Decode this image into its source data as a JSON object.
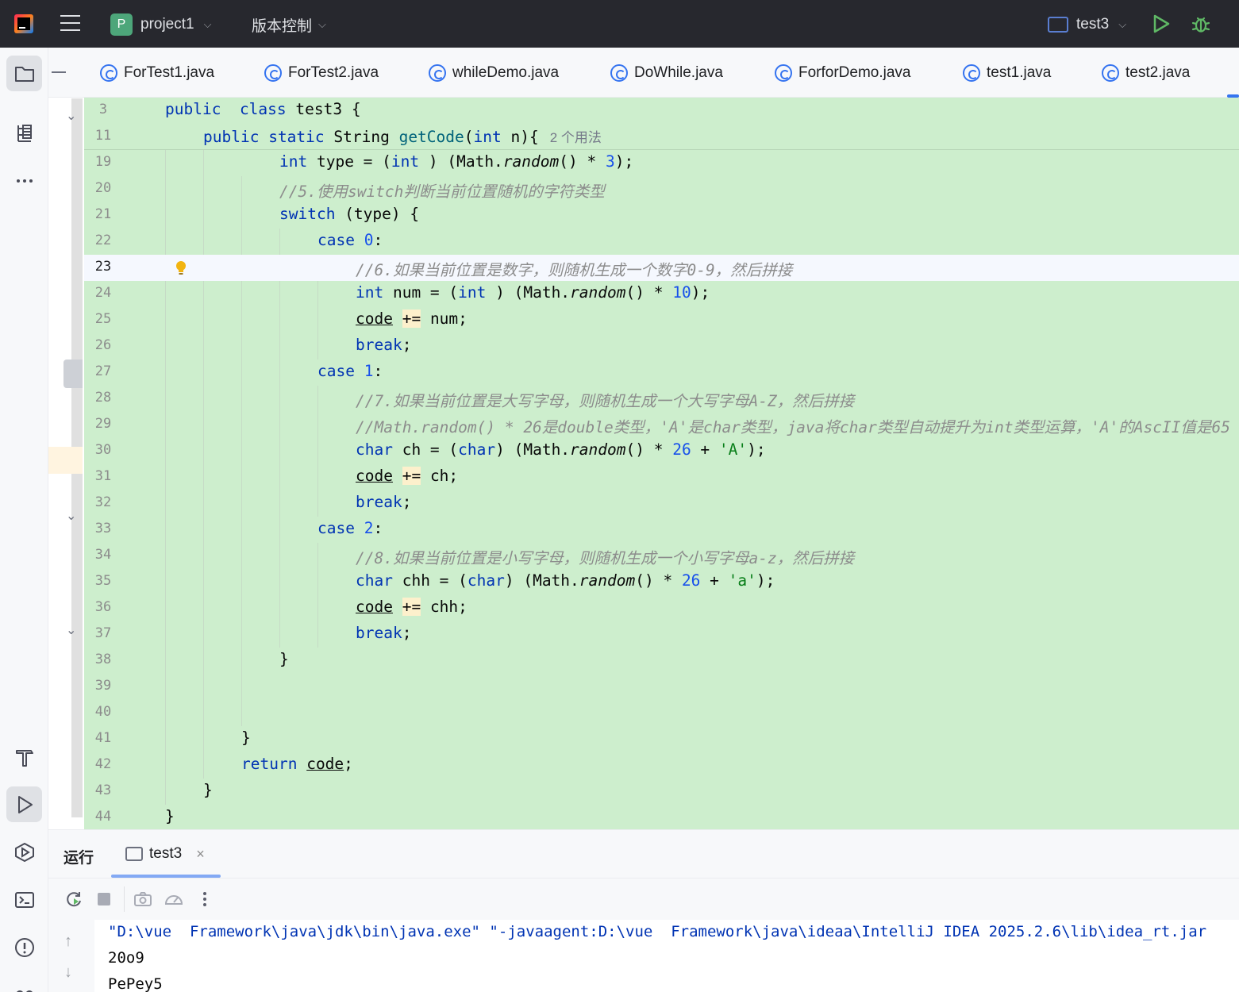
{
  "titlebar": {
    "project_badge": "P",
    "project_name": "project1",
    "vcs_label": "版本控制",
    "run_config": "test3"
  },
  "tabs": [
    {
      "label": "ForTest1.java"
    },
    {
      "label": "ForTest2.java"
    },
    {
      "label": "whileDemo.java"
    },
    {
      "label": "DoWhile.java"
    },
    {
      "label": "ForforDemo.java"
    },
    {
      "label": "test1.java"
    },
    {
      "label": "test2.java"
    }
  ],
  "editor": {
    "caret_line": 23,
    "inlay_hint": "2 个用法",
    "lines": [
      {
        "n": "3",
        "indent": 2,
        "tokens": [
          [
            "kw",
            "public"
          ],
          [
            "",
            "  "
          ],
          [
            "kw",
            "class"
          ],
          [
            "",
            " test3 {"
          ]
        ]
      },
      {
        "n": "11",
        "indent": 3,
        "tokens": [
          [
            "kw",
            "public"
          ],
          [
            "",
            " "
          ],
          [
            "kw",
            "static"
          ],
          [
            "",
            " String "
          ],
          [
            "fn",
            "getCode"
          ],
          [
            "",
            "("
          ],
          [
            "kw",
            "int"
          ],
          [
            "",
            " n){"
          ]
        ],
        "hint": true
      },
      {
        "n": "19",
        "indent": 5,
        "tokens": [
          [
            "kw",
            "int"
          ],
          [
            "",
            " type = ("
          ],
          [
            "kw",
            "int"
          ],
          [
            "",
            " ) (Math."
          ],
          [
            "it",
            "random"
          ],
          [
            "",
            "() * "
          ],
          [
            "num",
            "3"
          ],
          [
            "",
            ");"
          ]
        ]
      },
      {
        "n": "20",
        "indent": 5,
        "tokens": [
          [
            "cm",
            "//5.使用switch判断当前位置随机的字符类型"
          ]
        ]
      },
      {
        "n": "21",
        "indent": 5,
        "tokens": [
          [
            "kw",
            "switch"
          ],
          [
            "",
            " (type) {"
          ]
        ]
      },
      {
        "n": "22",
        "indent": 6,
        "tokens": [
          [
            "kw",
            "case"
          ],
          [
            "",
            " "
          ],
          [
            "num",
            "0"
          ],
          [
            "",
            ":"
          ]
        ]
      },
      {
        "n": "23",
        "indent": 7,
        "tokens": [
          [
            "cm",
            "//6.如果当前位置是数字，则随机生成一个数字0-9，然后拼接"
          ]
        ],
        "bulb": true
      },
      {
        "n": "24",
        "indent": 7,
        "tokens": [
          [
            "kw",
            "int"
          ],
          [
            "",
            " num = ("
          ],
          [
            "kw",
            "int"
          ],
          [
            "",
            " ) (Math."
          ],
          [
            "it",
            "random"
          ],
          [
            "",
            "() * "
          ],
          [
            "num",
            "10"
          ],
          [
            "",
            ");"
          ]
        ]
      },
      {
        "n": "25",
        "indent": 7,
        "tokens": [
          [
            "ul",
            "code"
          ],
          [
            "",
            " "
          ],
          [
            "op",
            "+="
          ],
          [
            "",
            " num;"
          ]
        ]
      },
      {
        "n": "26",
        "indent": 7,
        "tokens": [
          [
            "kw",
            "break"
          ],
          [
            "",
            ";"
          ]
        ]
      },
      {
        "n": "27",
        "indent": 6,
        "tokens": [
          [
            "kw",
            "case"
          ],
          [
            "",
            " "
          ],
          [
            "num",
            "1"
          ],
          [
            "",
            ":"
          ]
        ]
      },
      {
        "n": "28",
        "indent": 7,
        "tokens": [
          [
            "cm",
            "//7.如果当前位置是大写字母，则随机生成一个大写字母A-Z，然后拼接"
          ]
        ]
      },
      {
        "n": "29",
        "indent": 7,
        "tokens": [
          [
            "cm",
            "//Math.random() * 26是double类型，'A'是char类型，java将char类型自动提升为int类型运算，'A'的AscII值是65"
          ]
        ]
      },
      {
        "n": "30",
        "indent": 7,
        "tokens": [
          [
            "kw",
            "char"
          ],
          [
            "",
            " ch = ("
          ],
          [
            "kw",
            "char"
          ],
          [
            "",
            ") (Math."
          ],
          [
            "it",
            "random"
          ],
          [
            "",
            "() * "
          ],
          [
            "num",
            "26"
          ],
          [
            "",
            " + "
          ],
          [
            "str",
            "'A'"
          ],
          [
            "",
            ");"
          ]
        ]
      },
      {
        "n": "31",
        "indent": 7,
        "tokens": [
          [
            "ul",
            "code"
          ],
          [
            "",
            " "
          ],
          [
            "op",
            "+="
          ],
          [
            "",
            " ch;"
          ]
        ]
      },
      {
        "n": "32",
        "indent": 7,
        "tokens": [
          [
            "kw",
            "break"
          ],
          [
            "",
            ";"
          ]
        ]
      },
      {
        "n": "33",
        "indent": 6,
        "tokens": [
          [
            "kw",
            "case"
          ],
          [
            "",
            " "
          ],
          [
            "num",
            "2"
          ],
          [
            "",
            ":"
          ]
        ]
      },
      {
        "n": "34",
        "indent": 7,
        "tokens": [
          [
            "cm",
            "//8.如果当前位置是小写字母，则随机生成一个小写字母a-z，然后拼接"
          ]
        ]
      },
      {
        "n": "35",
        "indent": 7,
        "tokens": [
          [
            "kw",
            "char"
          ],
          [
            "",
            " chh = ("
          ],
          [
            "kw",
            "char"
          ],
          [
            "",
            ") (Math."
          ],
          [
            "it",
            "random"
          ],
          [
            "",
            "() * "
          ],
          [
            "num",
            "26"
          ],
          [
            "",
            " + "
          ],
          [
            "str",
            "'a'"
          ],
          [
            "",
            ");"
          ]
        ]
      },
      {
        "n": "36",
        "indent": 7,
        "tokens": [
          [
            "ul",
            "code"
          ],
          [
            "",
            " "
          ],
          [
            "op",
            "+="
          ],
          [
            "",
            " chh;"
          ]
        ]
      },
      {
        "n": "37",
        "indent": 7,
        "tokens": [
          [
            "kw",
            "break"
          ],
          [
            "",
            ";"
          ]
        ]
      },
      {
        "n": "38",
        "indent": 5,
        "tokens": [
          [
            "",
            "}"
          ]
        ]
      },
      {
        "n": "39",
        "indent": 0,
        "tokens": []
      },
      {
        "n": "40",
        "indent": 0,
        "tokens": []
      },
      {
        "n": "41",
        "indent": 4,
        "tokens": [
          [
            "",
            "}"
          ]
        ]
      },
      {
        "n": "42",
        "indent": 4,
        "tokens": [
          [
            "kw",
            "return"
          ],
          [
            "",
            " "
          ],
          [
            "ul",
            "code"
          ],
          [
            "",
            ";"
          ]
        ]
      },
      {
        "n": "43",
        "indent": 3,
        "tokens": [
          [
            "",
            "}"
          ]
        ]
      },
      {
        "n": "44",
        "indent": 2,
        "tokens": [
          [
            "",
            "}"
          ]
        ]
      }
    ]
  },
  "run_panel": {
    "title": "运行",
    "tab_label": "test3",
    "tab_close": "×",
    "console": [
      "\"D:\\vue  Framework\\java\\jdk\\bin\\java.exe\" \"-javaagent:D:\\vue  Framework\\java\\ideaa\\IntelliJ IDEA 2025.2.6\\lib\\idea_rt.jar",
      "20o9",
      "PePey5"
    ]
  },
  "colors": {
    "titlebar_bg": "#27282e",
    "editor_bg": "#cdeecd",
    "keyword": "#0033b3",
    "number": "#1750eb",
    "string": "#067d17",
    "comment": "#8c8c8c",
    "accent": "#3574f0"
  }
}
